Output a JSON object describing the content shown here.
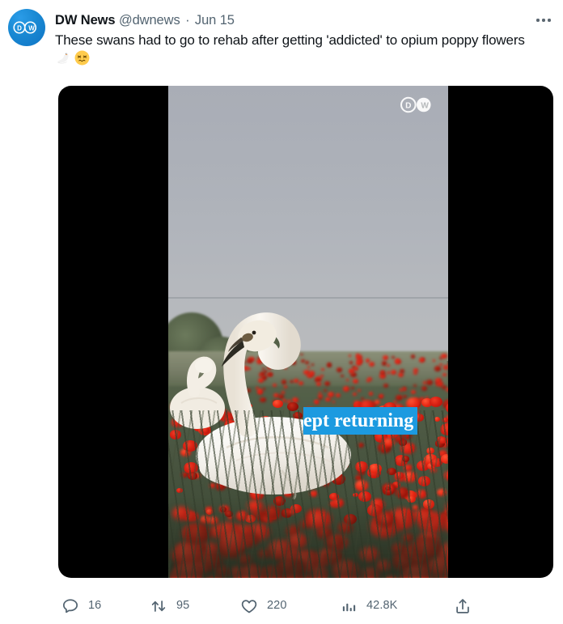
{
  "post": {
    "author": {
      "display_name": "DW News",
      "handle": "@dwnews",
      "separator": "·",
      "timestamp": "Jun 15",
      "avatar_icon": "dw-logo-icon",
      "avatar_bg_color": "#1a8ad4"
    },
    "text_line1": "These swans had to go to rehab after getting 'addicted' to opium poppy",
    "text_line2": "flowers",
    "emoji_1": "swan-emoji",
    "emoji_2": "woozy-face-emoji",
    "more_menu_label": "More"
  },
  "media": {
    "type": "video",
    "watermark_icon": "dw-logo-watermark-icon",
    "caption_text": "ept returning",
    "caption_bg_color": "#1c9ae0",
    "caption_text_color": "#ffffff",
    "letterbox_color": "#000000",
    "scene_description": "swan in red poppy field"
  },
  "actions": {
    "reply": {
      "icon": "reply-icon",
      "count": "16"
    },
    "retweet": {
      "icon": "retweet-icon",
      "count": "95"
    },
    "like": {
      "icon": "heart-icon",
      "count": "220"
    },
    "views": {
      "icon": "analytics-bar-icon",
      "count": "42.8K"
    },
    "share": {
      "icon": "share-upload-icon",
      "count": ""
    }
  },
  "colors": {
    "text_primary": "#0f1419",
    "text_secondary": "#536471",
    "background": "#ffffff",
    "accent_blue": "#1c9ae0"
  }
}
